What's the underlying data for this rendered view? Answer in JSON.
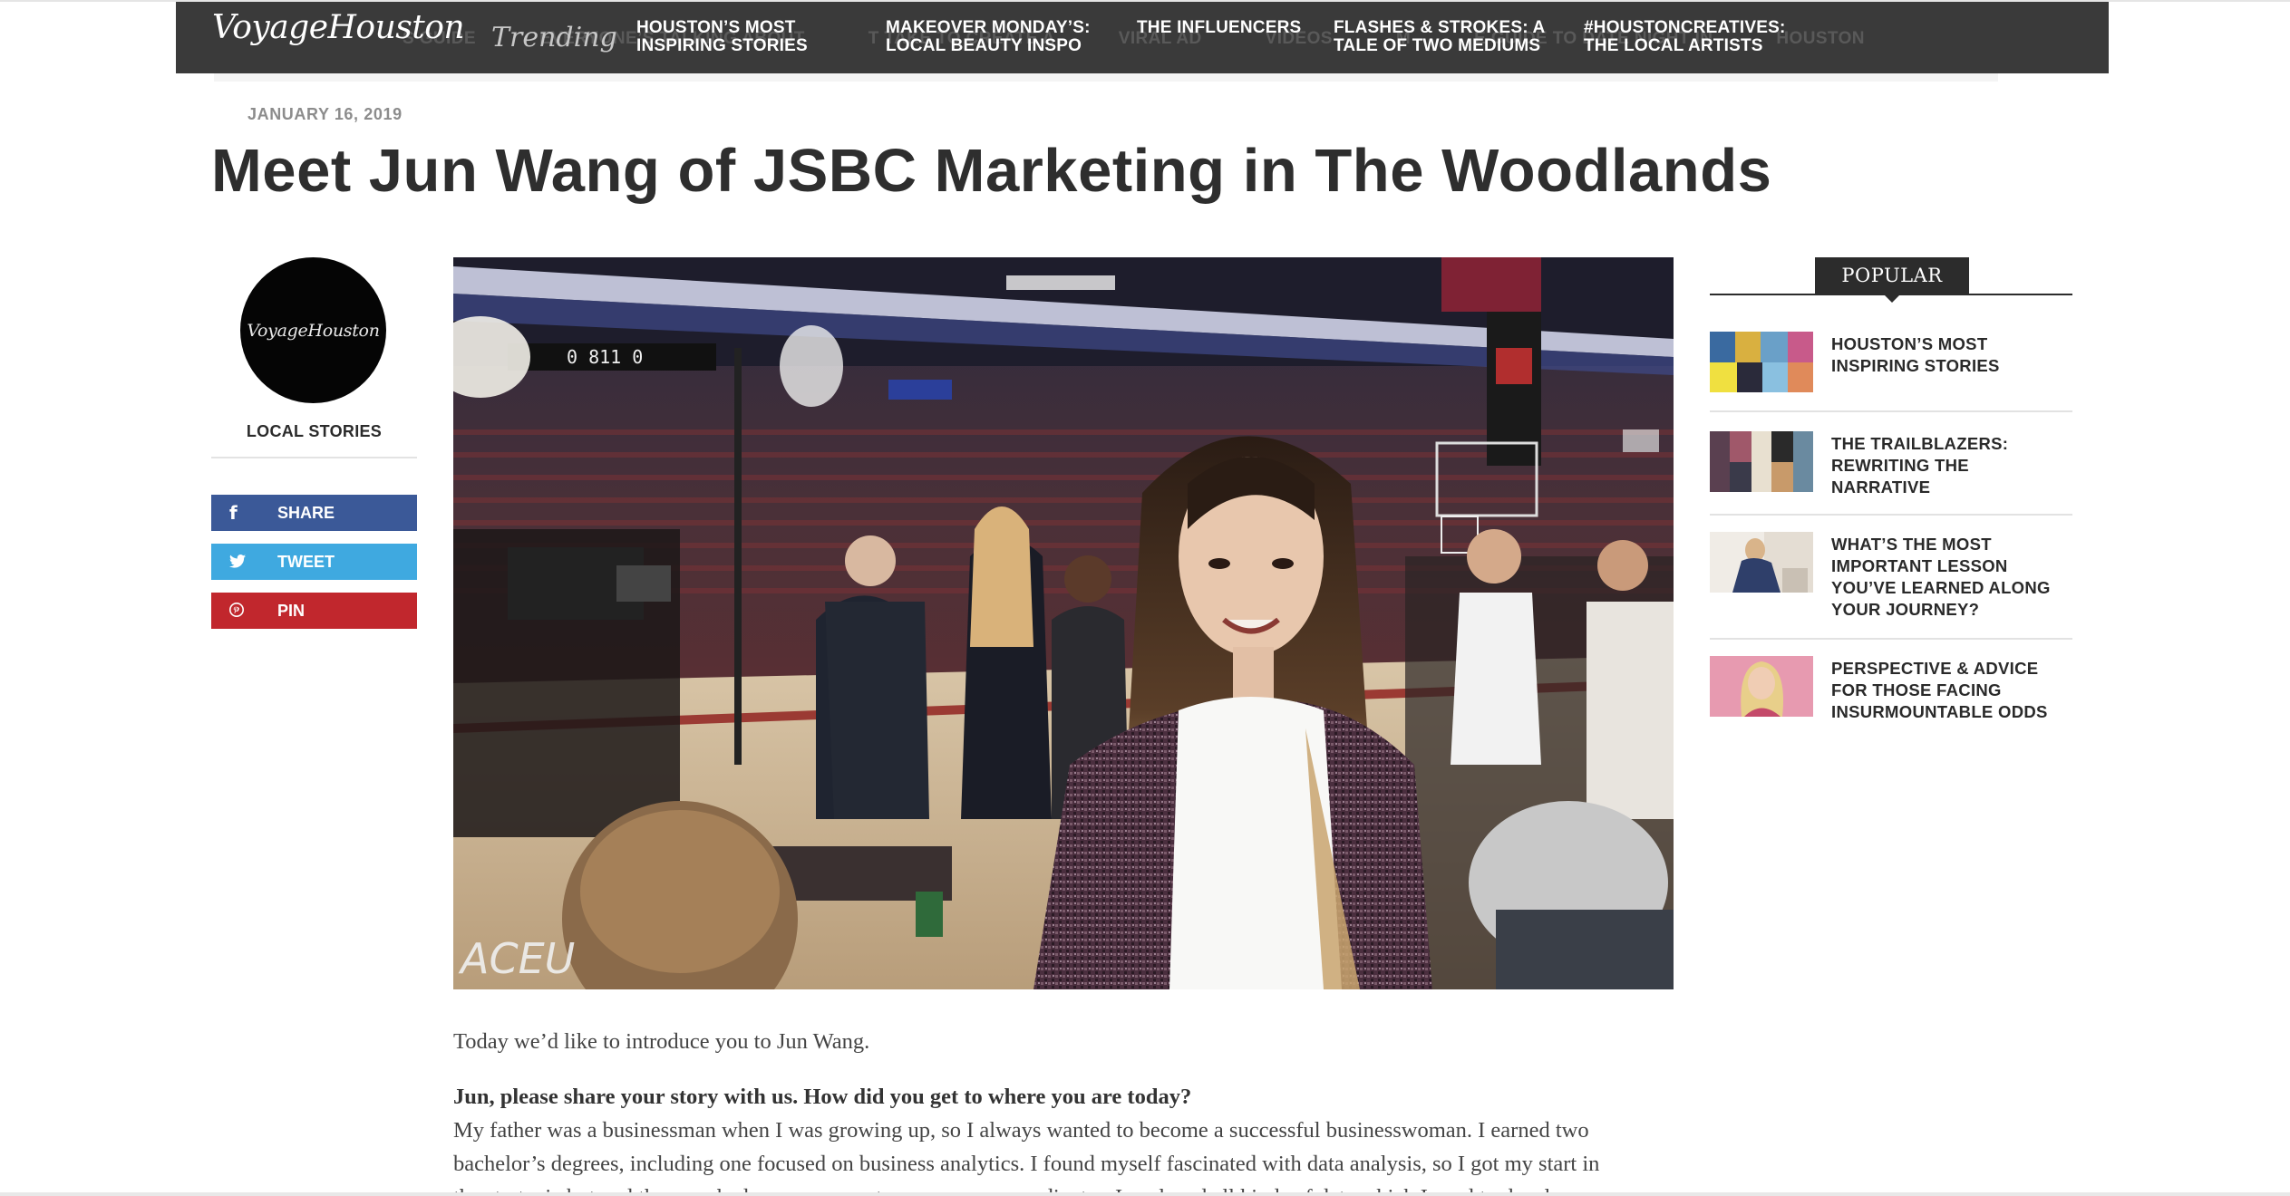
{
  "nav": {
    "logo": "VoyageHouston",
    "trending": "Trending",
    "links": [
      {
        "l1": "HOUSTON’S MOST",
        "l2": "INSPIRING STORIES"
      },
      {
        "l1": "MAKEOVER MONDAY’S:",
        "l2": "LOCAL BEAUTY INSPO"
      },
      {
        "l1": "THE INFLUENCERS",
        "l2": ""
      },
      {
        "l1": "FLASHES & STROKES: A",
        "l2": "TALE OF TWO MEDIUMS"
      },
      {
        "l1": "#HOUSTONCREATIVES:",
        "l2": "THE LOCAL ARTISTS"
      }
    ],
    "ghost_text": [
      "S GUIDE",
      "EVERYONE’S TALKING ABOUT",
      "T TAKE TO CREATE A",
      "VIRAL AD",
      "VIDEOS",
      "M",
      "E GUIDE TO DATE NIGHT IN",
      "HOUSTON"
    ]
  },
  "article": {
    "date": "JANUARY 16, 2019",
    "title": "Meet Jun Wang of JSBC Marketing in The Woodlands",
    "intro": "Today we’d like to introduce you to Jun Wang.",
    "question": "Jun, please share your story with us. How did you get to where you are today?",
    "answer_line1": "My father was a businessman when I was growing up, so I always wanted to become a successful businesswoman. I earned two",
    "answer_line2": "bachelor’s degrees, including one focused on business analytics. I found myself fascinated with data analysis, so I got my start in",
    "answer_line3": "the strategic but and then worked on my career to ... manager coordinator. I analyzed all kinds of data which I used to develop"
  },
  "author": {
    "avatar_text": "VoyageHouston",
    "category": "LOCAL STORIES"
  },
  "share": {
    "share_label": "SHARE",
    "tweet_label": "TWEET",
    "pin_label": "PIN",
    "share_icon": "facebook-icon",
    "tweet_icon": "twitter-icon",
    "pin_icon": "pinterest-icon",
    "colors": {
      "share": "#3b5998",
      "tweet": "#3fa9e0",
      "pin": "#c1272d"
    }
  },
  "popular": {
    "heading": "POPULAR",
    "items": [
      {
        "title": "HOUSTON’S MOST INSPIRING STORIES"
      },
      {
        "title": "THE TRAILBLAZERS: REWRITING THE NARRATIVE"
      },
      {
        "title": "WHAT’S THE MOST IMPORTANT LESSON YOU’VE LEARNED ALONG YOUR JOURNEY?"
      },
      {
        "title": "PERSPECTIVE & ADVICE FOR THOSE FACING INSURMOUNTABLE ODDS"
      }
    ]
  },
  "photo": {
    "scoreboard_text": "0 811 0",
    "camera_text": "ACEU"
  }
}
